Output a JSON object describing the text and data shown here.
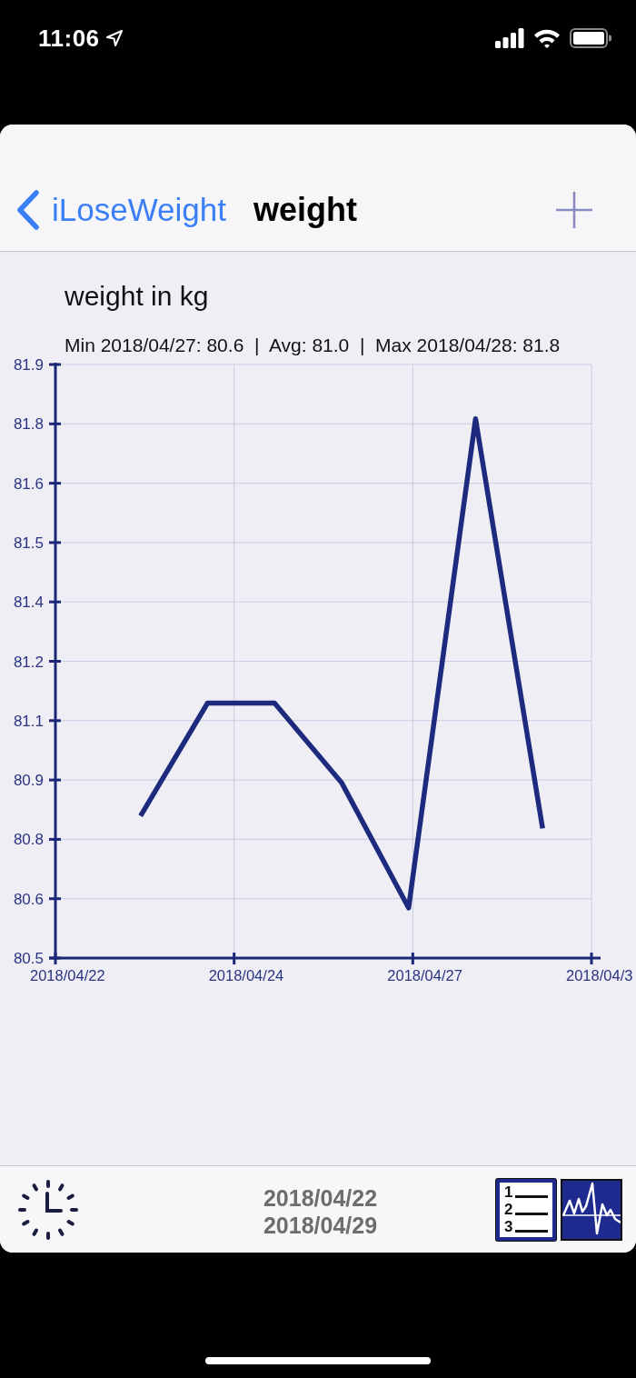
{
  "status_bar": {
    "time": "11:06"
  },
  "nav_bar": {
    "back_label": "iLoseWeight",
    "title": "weight"
  },
  "chart": {
    "summary": "Min 2018/04/27: 80.6  |  Avg: 81.0  |  Max 2018/04/28: 81.8",
    "x_axis_labels": [
      "2018/04/22",
      "2018/04/24",
      "2018/04/27",
      "2018/04/3"
    ],
    "chart_data": {
      "type": "line",
      "title": "weight in kg",
      "grid": true,
      "categories": [
        null,
        null,
        null,
        null,
        null,
        null,
        null
      ],
      "series": [
        {
          "color": "#1e2a7e",
          "values": [
            80.84,
            81.11,
            81.11,
            80.92,
            80.62,
            81.79,
            80.81
          ]
        }
      ],
      "ylim": [
        80.5,
        81.92
      ],
      "yticks": [
        {
          "value": 80.5,
          "label": "80.5"
        },
        {
          "value": 80.642,
          "label": "80.6"
        },
        {
          "value": 80.784,
          "label": "80.8"
        },
        {
          "value": 80.926,
          "label": "80.9"
        },
        {
          "value": 81.068,
          "label": "81.1"
        },
        {
          "value": 81.21,
          "label": "81.2"
        },
        {
          "value": 81.352,
          "label": "81.4"
        },
        {
          "value": 81.494,
          "label": "81.5"
        },
        {
          "value": 81.636,
          "label": "81.6"
        },
        {
          "value": 81.778,
          "label": "81.8"
        },
        {
          "value": 81.92,
          "label": "81.9"
        }
      ]
    }
  },
  "toolbar": {
    "date_range": [
      "2018/04/22",
      "2018/04/29"
    ],
    "list_markers": [
      "1",
      "2",
      "3"
    ]
  }
}
